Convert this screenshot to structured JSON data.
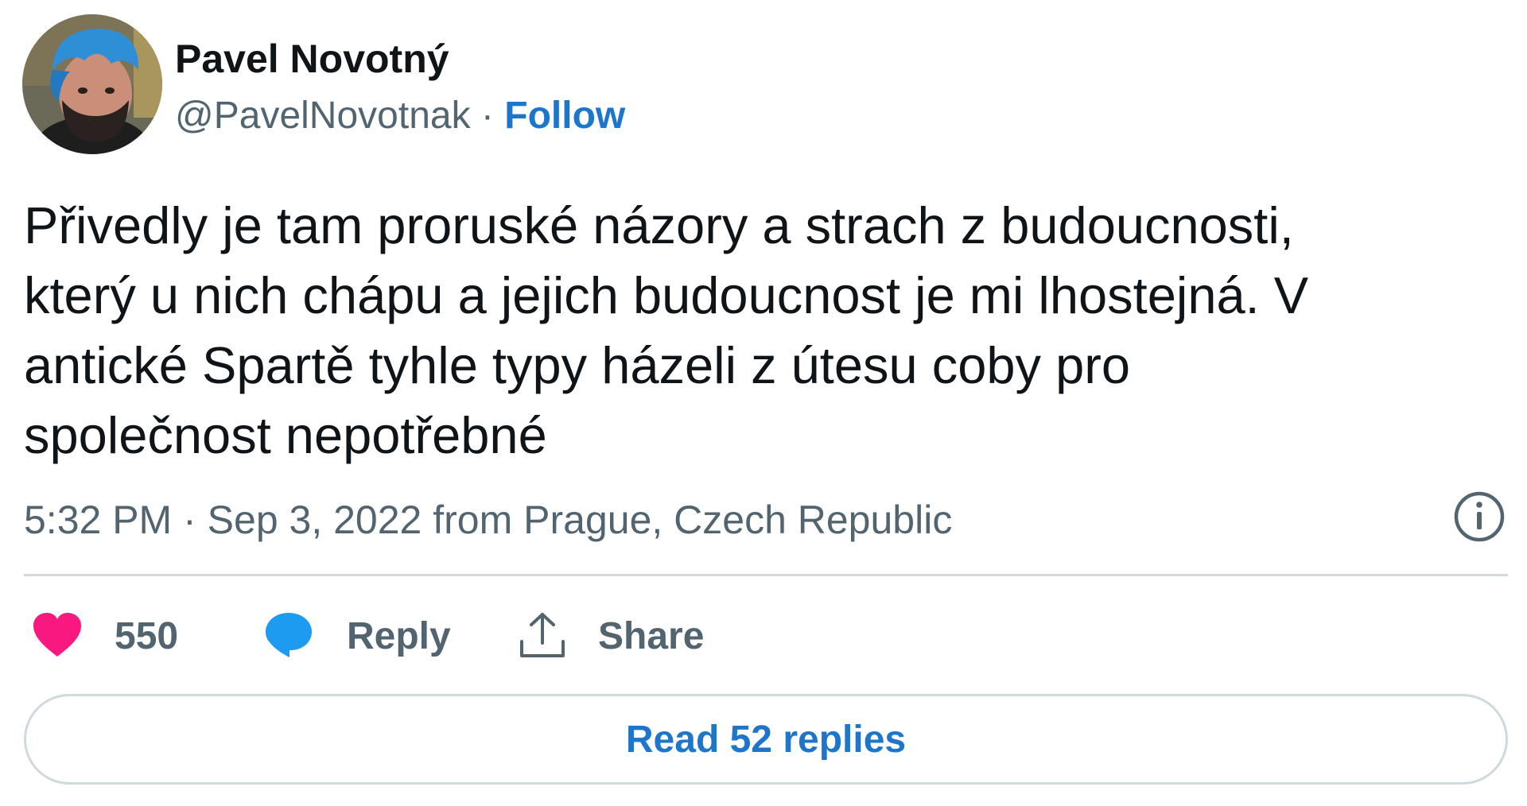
{
  "author": {
    "name": "Pavel Novotný",
    "handle": "@PavelNovotnak",
    "separator": "·",
    "follow_label": "Follow"
  },
  "tweet": {
    "text": "Přivedly je tam proruské názory a strach z budoucnosti,\nkterý u nich chápu a jejich budoucnost je mi lhostejná. V\nantické Spartě tyhle typy házeli z útesu coby pro\nspolečnost nepotřebné",
    "time": "5:32 PM",
    "date_separator": " · ",
    "date": "Sep 3, 2022",
    "from_text": " from ",
    "location": "Prague, Czech Republic"
  },
  "actions": {
    "like_count": "550",
    "reply_label": "Reply",
    "share_label": "Share"
  },
  "read_replies_label": "Read 52 replies",
  "icons": {
    "like": "heart-icon",
    "reply": "speech-bubble-icon",
    "share": "share-upload-icon",
    "info": "info-icon"
  },
  "colors": {
    "like": "#f91880",
    "reply": "#1d9bf0",
    "link": "#1d76c9",
    "secondary_text": "#536471",
    "avatar_hair": "#2f8fd6"
  }
}
